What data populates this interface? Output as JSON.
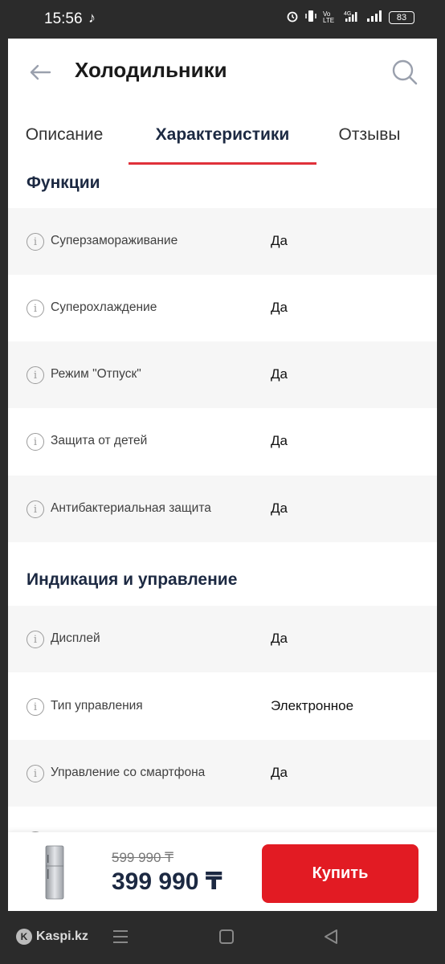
{
  "status_bar": {
    "time": "15:56",
    "battery": "83",
    "network": "4G",
    "volte": "Vo LTE"
  },
  "header": {
    "title": "Холодильники"
  },
  "tabs": [
    {
      "label": "Описание",
      "active": false
    },
    {
      "label": "Характеристики",
      "active": true
    },
    {
      "label": "Отзывы",
      "active": false
    }
  ],
  "sections": [
    {
      "title": "Функции",
      "rows": [
        {
          "label": "Суперзамораживание",
          "value": "Да"
        },
        {
          "label": "Суперохлаждение",
          "value": "Да"
        },
        {
          "label": "Режим \"Отпуск\"",
          "value": "Да"
        },
        {
          "label": "Защита от детей",
          "value": "Да"
        },
        {
          "label": "Антибактериальная защита",
          "value": "Да"
        }
      ]
    },
    {
      "title": "Индикация и управление",
      "rows": [
        {
          "label": "Дисплей",
          "value": "Да"
        },
        {
          "label": "Тип управления",
          "value": "Электронное"
        },
        {
          "label": "Управление со смартфона",
          "value": "Да"
        }
      ]
    }
  ],
  "buy_bar": {
    "old_price": "599 990 ₸",
    "new_price": "399 990 ₸",
    "buy_label": "Купить"
  },
  "watermark": {
    "text": "Kaspi.kz"
  },
  "colors": {
    "accent": "#e21b23",
    "tab_underline": "#e0313a",
    "heading": "#1c2942"
  }
}
